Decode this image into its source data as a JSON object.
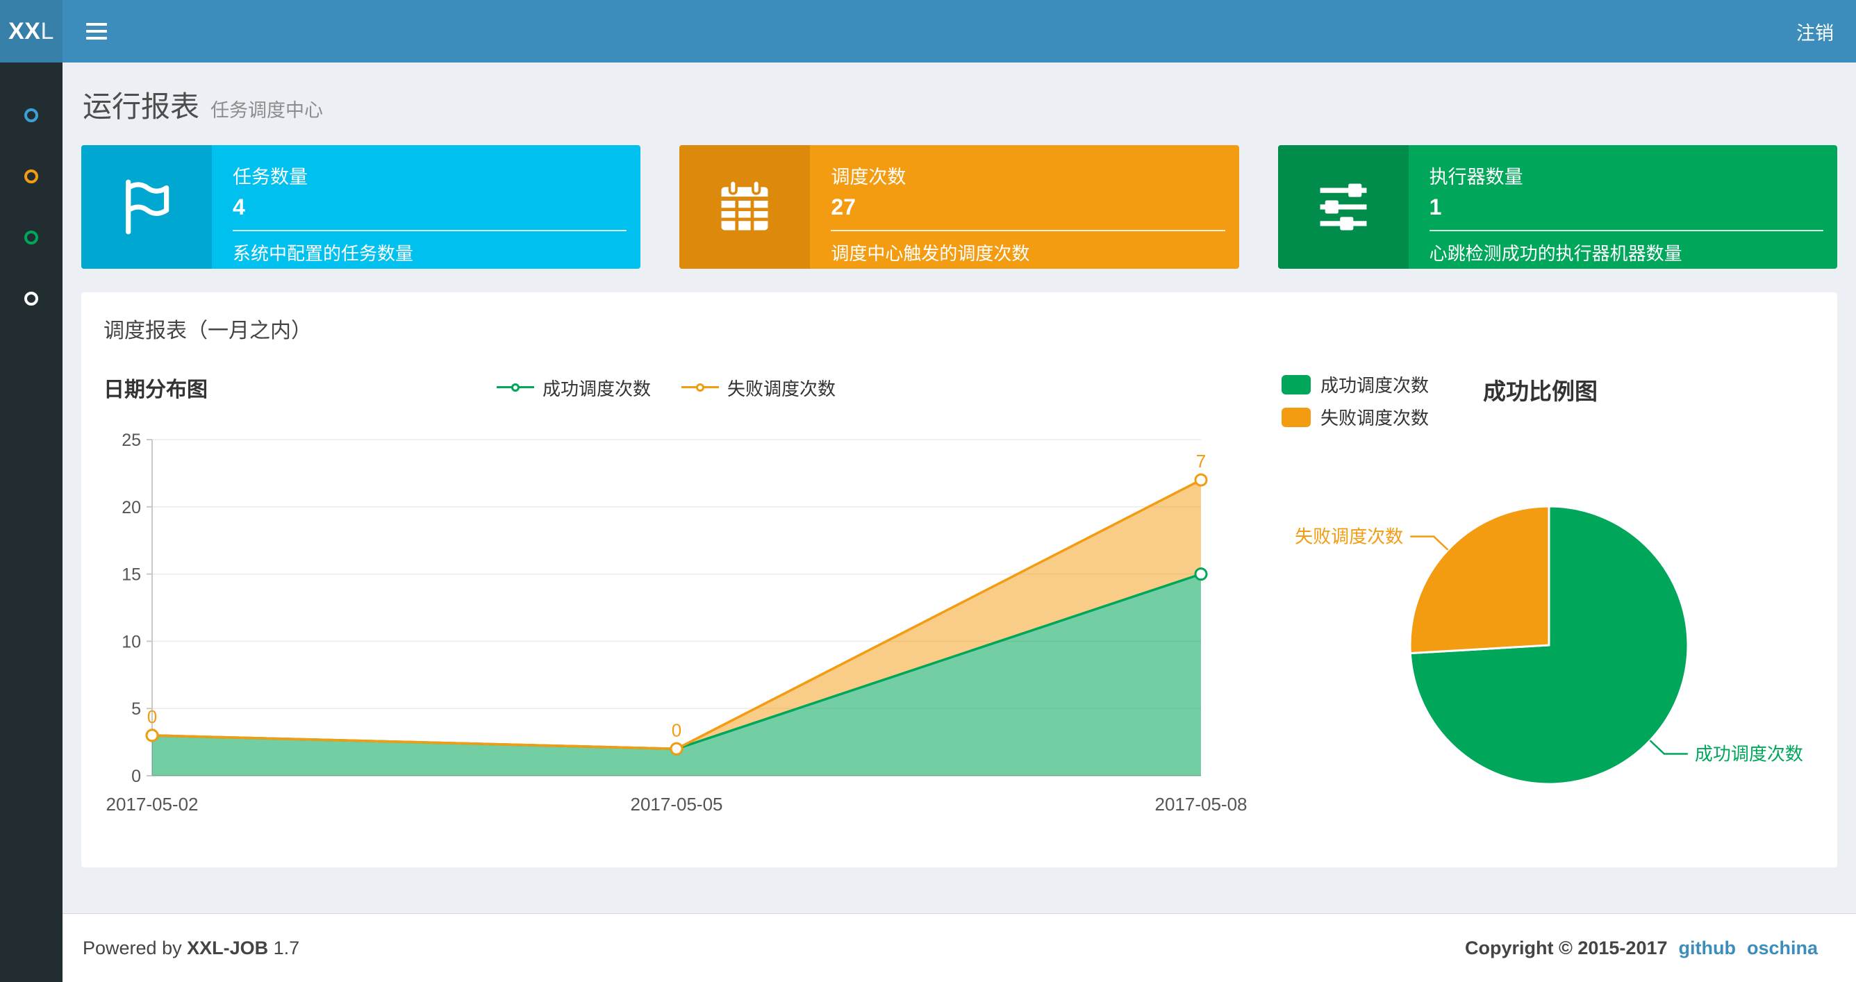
{
  "navbar": {
    "logo_bold": "XX",
    "logo_light": "L",
    "logout_label": "注销"
  },
  "sidebar": {
    "items": [
      {
        "icon": "circle-icon",
        "color": "#3da0d5"
      },
      {
        "icon": "circle-icon",
        "color": "#f39c12"
      },
      {
        "icon": "circle-icon",
        "color": "#00a65a"
      },
      {
        "icon": "circle-icon",
        "color": "#ffffff"
      }
    ]
  },
  "page_header": {
    "title": "运行报表",
    "subtitle": "任务调度中心"
  },
  "info_boxes": [
    {
      "icon": "flag-icon",
      "color": "#00c0ef",
      "icon_bg": "#00a7d0",
      "title": "任务数量",
      "value": "4",
      "description": "系统中配置的任务数量"
    },
    {
      "icon": "calendar-icon",
      "color": "#f39c12",
      "icon_bg": "#dd8a0c",
      "title": "调度次数",
      "value": "27",
      "description": "调度中心触发的调度次数"
    },
    {
      "icon": "sliders-icon",
      "color": "#00a65a",
      "icon_bg": "#008d4c",
      "title": "执行器数量",
      "value": "1",
      "description": "心跳检测成功的执行器机器数量"
    }
  ],
  "panel": {
    "title": "调度报表（一月之内）"
  },
  "chart_data": [
    {
      "type": "area",
      "title": "日期分布图",
      "categories": [
        "2017-05-02",
        "2017-05-05",
        "2017-05-08"
      ],
      "series": [
        {
          "name": "成功调度次数",
          "color": "#00a65a",
          "values": [
            3,
            2,
            15
          ]
        },
        {
          "name": "失败调度次数",
          "color": "#f39c12",
          "values": [
            0,
            0,
            7
          ],
          "show_labels": true
        }
      ],
      "stacked": true,
      "ylim": [
        0,
        25
      ],
      "yticks": [
        0,
        5,
        10,
        15,
        20,
        25
      ],
      "legend_position": "top-center",
      "grid": true
    },
    {
      "type": "pie",
      "title": "成功比例图",
      "slices": [
        {
          "name": "成功调度次数",
          "value": 20,
          "color": "#00a65a"
        },
        {
          "name": "失败调度次数",
          "value": 7,
          "color": "#f39c12"
        }
      ],
      "legend_position": "top-left"
    }
  ],
  "footer": {
    "powered_by": "Powered by",
    "product": "XXL-JOB",
    "version": "1.7",
    "copyright": "Copyright © 2015-2017",
    "links": [
      {
        "label": "github",
        "color": "#3c8dbc"
      },
      {
        "label": "oschina",
        "color": "#3c8dbc"
      }
    ]
  }
}
